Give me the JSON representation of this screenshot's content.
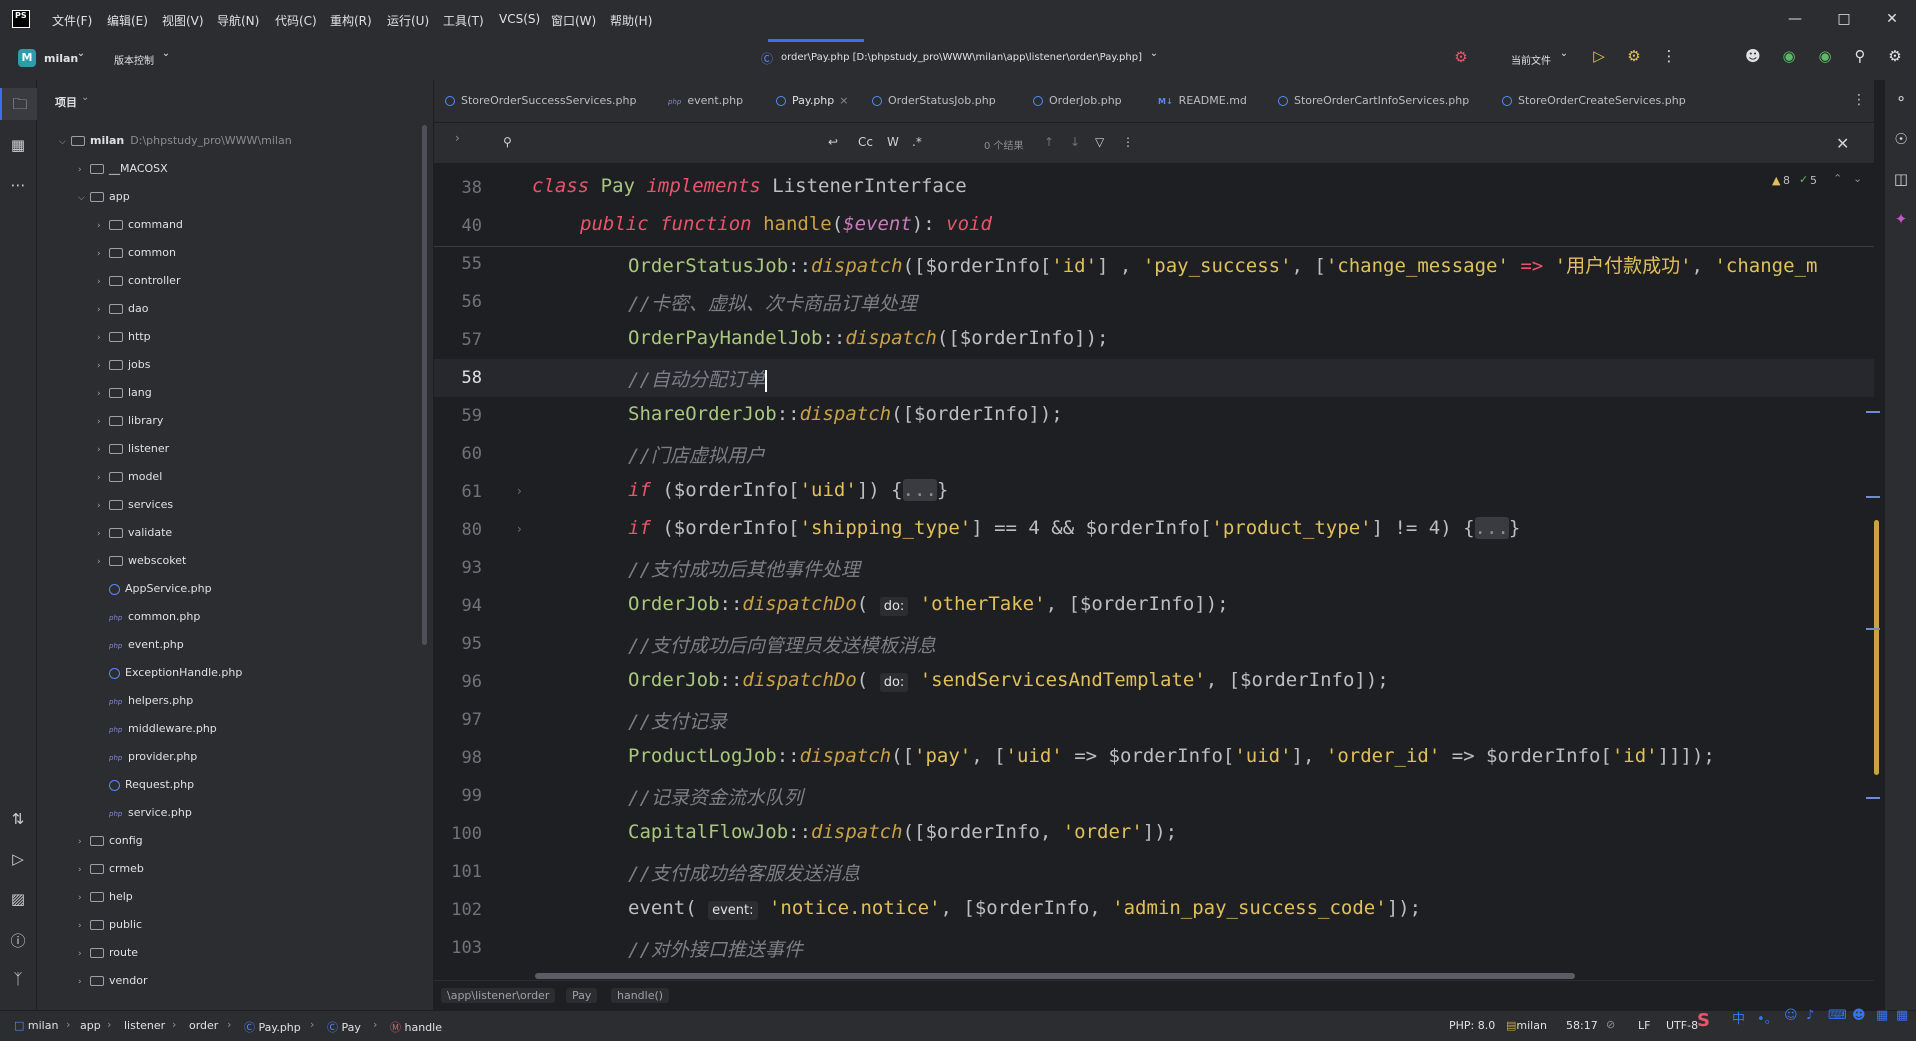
{
  "menu": [
    "文件(F)",
    "编辑(E)",
    "视图(V)",
    "导航(N)",
    "代码(C)",
    "重构(R)",
    "运行(U)",
    "工具(T)",
    "VCS(S)",
    "窗口(W)",
    "帮助(H)"
  ],
  "window_title": "order\\Pay.php [D:\\phpstudy_pro\\WWW\\milan\\app\\listener\\order\\Pay.php]",
  "toolbar": {
    "project_initial": "M",
    "project_name": "milan",
    "vcs": "版本控制",
    "run_config": "当前文件"
  },
  "project_panel": {
    "title": "项目",
    "root_name": "milan",
    "root_path": "D:\\phpstudy_pro\\WWW\\milan",
    "items": [
      {
        "label": "__MACOSX"
      },
      {
        "label": "app"
      },
      {
        "label": "command"
      },
      {
        "label": "common"
      },
      {
        "label": "controller"
      },
      {
        "label": "dao"
      },
      {
        "label": "http"
      },
      {
        "label": "jobs"
      },
      {
        "label": "lang"
      },
      {
        "label": "library"
      },
      {
        "label": "listener"
      },
      {
        "label": "model"
      },
      {
        "label": "services"
      },
      {
        "label": "validate"
      },
      {
        "label": "webscoket"
      },
      {
        "label": "AppService.php"
      },
      {
        "label": "common.php"
      },
      {
        "label": "event.php"
      },
      {
        "label": "ExceptionHandle.php"
      },
      {
        "label": "helpers.php"
      },
      {
        "label": "middleware.php"
      },
      {
        "label": "provider.php"
      },
      {
        "label": "Request.php"
      },
      {
        "label": "service.php"
      },
      {
        "label": "config"
      },
      {
        "label": "crmeb"
      },
      {
        "label": "help"
      },
      {
        "label": "public"
      },
      {
        "label": "route"
      },
      {
        "label": "vendor"
      }
    ]
  },
  "tabs": [
    "StoreOrderSuccessServices.php",
    "event.php",
    "Pay.php",
    "OrderStatusJob.php",
    "OrderJob.php",
    "README.md",
    "StoreOrderCartInfoServices.php",
    "StoreOrderCreateServices.php"
  ],
  "findbar": {
    "result": "0 个结果",
    "cc": "Cc",
    "w": "W",
    "regex": ".*"
  },
  "inspections": {
    "warnings": "8",
    "ok": "5"
  },
  "line_numbers": [
    "38",
    "40",
    "55",
    "56",
    "57",
    "58",
    "59",
    "60",
    "61",
    "80",
    "93",
    "94",
    "95",
    "96",
    "97",
    "98",
    "99",
    "100",
    "101",
    "102",
    "103"
  ],
  "code": {
    "l38": {
      "kw1": "class",
      "cls": "Pay",
      "kw2": "implements",
      "iface": "ListenerInterface"
    },
    "l40": {
      "kw1": "public",
      "kw2": "function",
      "fn": "handle",
      "var": "$event",
      "ret": "void"
    },
    "l55": {
      "cls": "OrderStatusJob",
      "fn": "dispatch",
      "rest1": "([$orderInfo[",
      "s1": "'id'",
      "rest2": "] , ",
      "s2": "'pay_success'",
      "rest3": ", [",
      "s3": "'change_message'",
      "rest4": " => ",
      "s4": "'用户付款成功'",
      "rest5": ", ",
      "s5": "'change_m"
    },
    "c56": "//卡密、虚拟、次卡商品订单处理",
    "l57": {
      "cls": "OrderPayHandelJob",
      "fn": "dispatch",
      "rest": "([$orderInfo]);"
    },
    "c58": "//自动分配订单",
    "l59": {
      "cls": "ShareOrderJob",
      "fn": "dispatch",
      "rest": "([$orderInfo]);"
    },
    "c60": "//门店虚拟用户",
    "l61": {
      "kw": "if",
      "a": " ($orderInfo[",
      "s": "'uid'",
      "b": "]) {",
      "fold": "...",
      "c": "}"
    },
    "l80": {
      "kw": "if",
      "a": " ($orderInfo[",
      "s1": "'shipping_type'",
      "b": "] == 4 && $orderInfo[",
      "s2": "'product_type'",
      "c": "] != 4) {",
      "fold": "...",
      "d": "}"
    },
    "c93": "//支付成功后其他事件处理",
    "l94": {
      "cls": "OrderJob",
      "fn": "dispatchDo",
      "hint": "do:",
      "s": "'otherTake'",
      "rest": ", [$orderInfo]);"
    },
    "c95": "//支付成功后向管理员发送模板消息",
    "l96": {
      "cls": "OrderJob",
      "fn": "dispatchDo",
      "hint": "do:",
      "s": "'sendServicesAndTemplate'",
      "rest": ", [$orderInfo]);"
    },
    "c97": "//支付记录",
    "l98": {
      "cls": "ProductLogJob",
      "fn": "dispatch",
      "a": "([",
      "s1": "'pay'",
      "b": ", [",
      "s2": "'uid'",
      "c": " => $orderInfo[",
      "s3": "'uid'",
      "d": "], ",
      "s4": "'order_id'",
      "e": " => $orderInfo[",
      "s5": "'id'",
      "f": "]]]);"
    },
    "c99": "//记录资金流水队列",
    "l100": {
      "cls": "CapitalFlowJob",
      "fn": "dispatch",
      "a": "([$orderInfo, ",
      "s": "'order'",
      "b": "]);"
    },
    "c101": "//支付成功给客服发送消息",
    "l102": {
      "fn": "event",
      "hint": "event:",
      "s1": "'notice.notice'",
      "a": ", [$orderInfo, ",
      "s2": "'admin_pay_success_code'",
      "b": "]);"
    },
    "c103": "//对外接口推送事件"
  },
  "editor_breadcrumb": [
    "\\app\\listener\\order",
    "Pay",
    "handle()"
  ],
  "statusbar": {
    "crumbs": [
      "milan",
      "app",
      "listener",
      "order",
      "Pay.php",
      "Pay",
      "handle"
    ],
    "php": "PHP: 8.0",
    "project": "milan",
    "pos": "58:17",
    "lf": "LF",
    "enc": "UTF-8"
  },
  "colors": {
    "accent": "#3574f0",
    "keyword": "#e8556b",
    "string": "#e0c05a",
    "comment": "#7a7e85",
    "function": "#c9a246"
  }
}
